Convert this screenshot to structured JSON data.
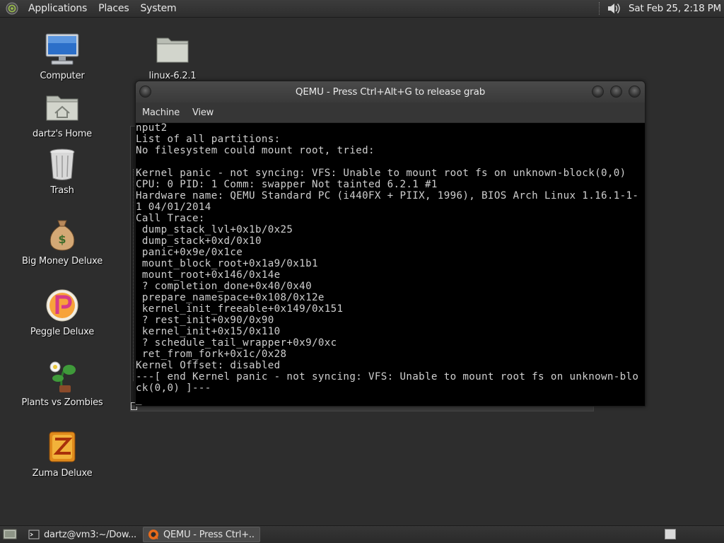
{
  "top_panel": {
    "menus": [
      "Applications",
      "Places",
      "System"
    ],
    "clock": "Sat Feb 25,  2:18 PM"
  },
  "desktop_icons": {
    "computer": "Computer",
    "linux": "linux-6.2.1",
    "home": "dartz's Home",
    "trash": "Trash",
    "big_money": "Big Money Deluxe",
    "peggle": "Peggle Deluxe",
    "pvz": "Plants vs Zombies",
    "zuma": "Zuma Deluxe"
  },
  "qemu_window": {
    "title": "QEMU - Press Ctrl+Alt+G to release grab",
    "menus": [
      "Machine",
      "View"
    ],
    "console_lines": [
      "nput2",
      "List of all partitions:",
      "No filesystem could mount root, tried:",
      "",
      "Kernel panic - not syncing: VFS: Unable to mount root fs on unknown-block(0,0)",
      "CPU: 0 PID: 1 Comm: swapper Not tainted 6.2.1 #1",
      "Hardware name: QEMU Standard PC (i440FX + PIIX, 1996), BIOS Arch Linux 1.16.1-1-",
      "1 04/01/2014",
      "Call Trace:",
      " dump_stack_lvl+0x1b/0x25",
      " dump_stack+0xd/0x10",
      " panic+0x9e/0x1ce",
      " mount_block_root+0x1a9/0x1b1",
      " mount_root+0x146/0x14e",
      " ? completion_done+0x40/0x40",
      " prepare_namespace+0x108/0x12e",
      " kernel_init_freeable+0x149/0x151",
      " ? rest_init+0x90/0x90",
      " kernel_init+0x15/0x110",
      " ? schedule_tail_wrapper+0x9/0xc",
      " ret_from_fork+0x1c/0x28",
      "Kernel Offset: disabled",
      "---[ end Kernel panic - not syncing: VFS: Unable to mount root fs on unknown-blo",
      "ck(0,0) ]---"
    ]
  },
  "taskbar": {
    "tasks": [
      {
        "label": "dartz@vm3:~/Dow...",
        "icon": "terminal-icon",
        "active": false
      },
      {
        "label": "QEMU - Press Ctrl+...",
        "icon": "qemu-icon",
        "active": true
      }
    ]
  },
  "colors": {
    "desktop_bg": "#2d2d2d",
    "console_bg": "#000000",
    "console_text": "#cfcfcf"
  }
}
